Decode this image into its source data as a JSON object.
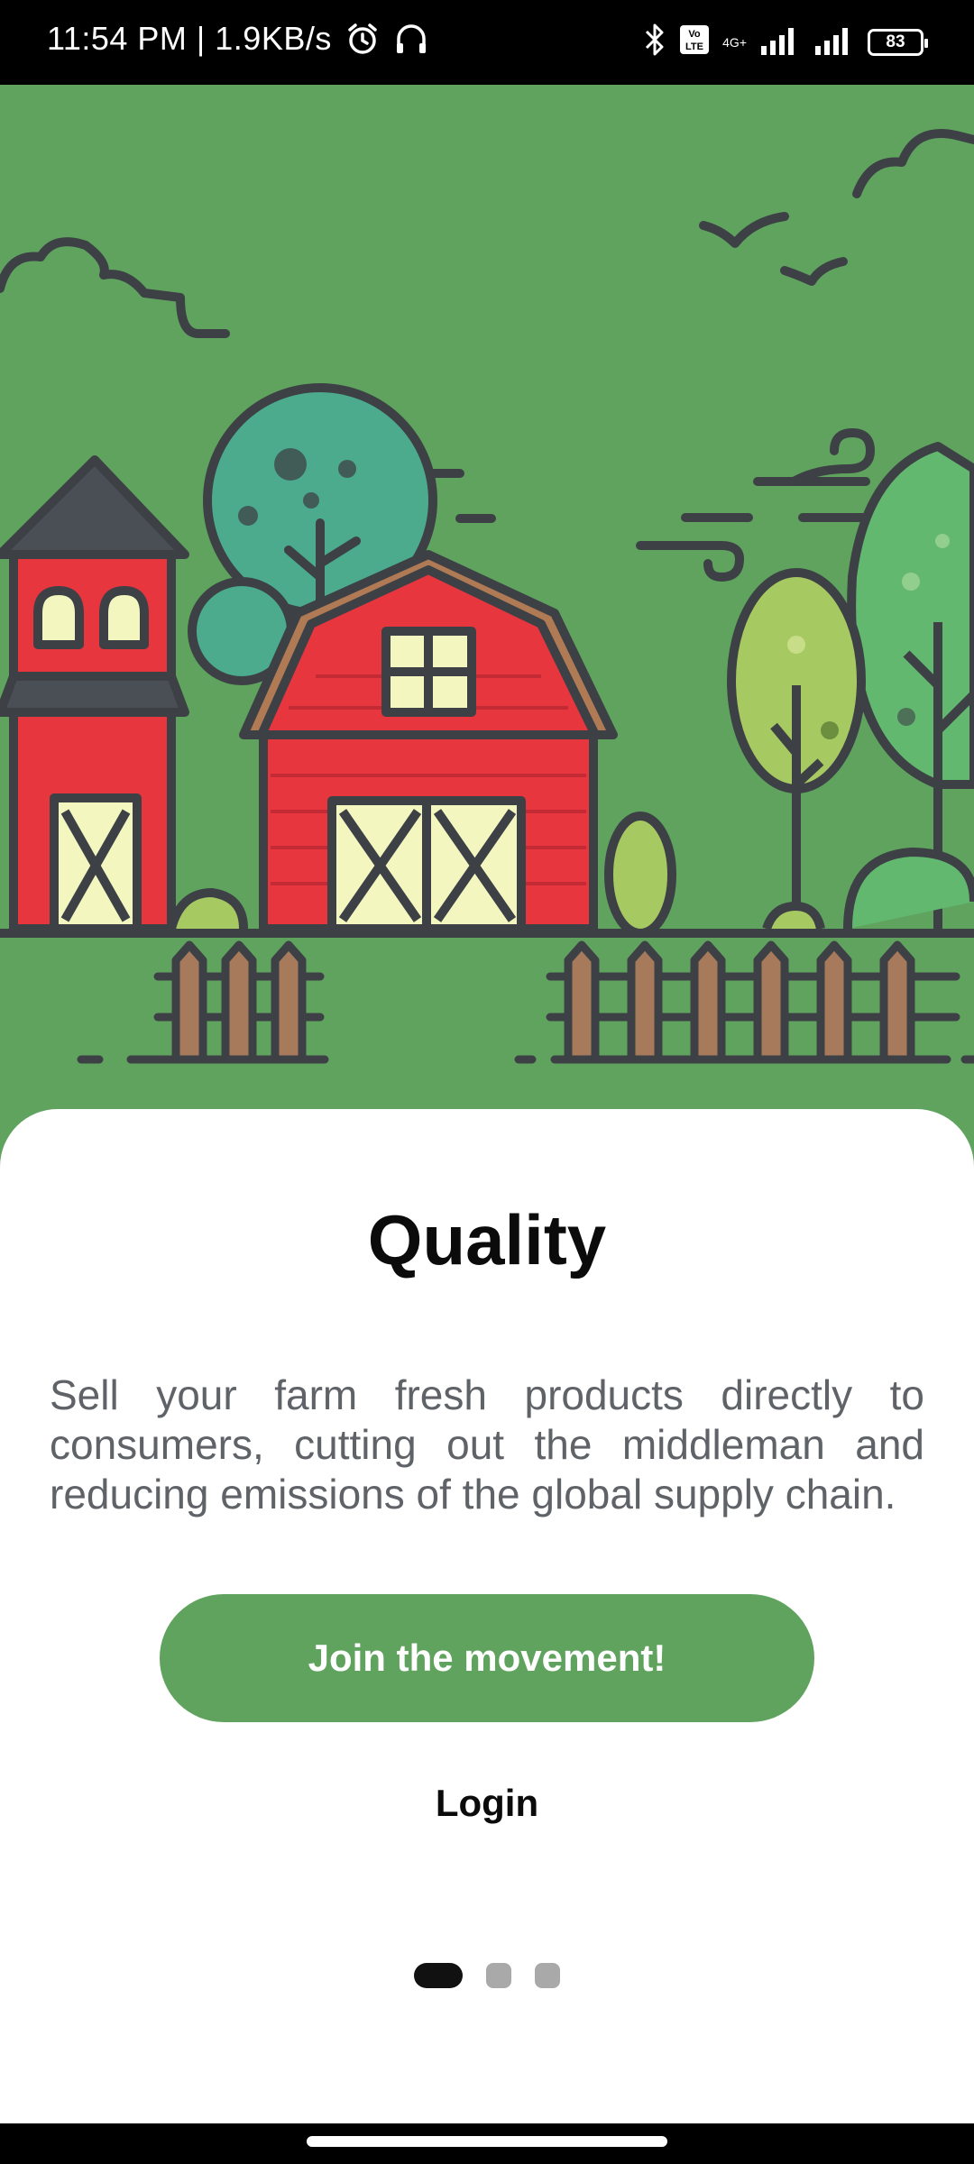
{
  "status_bar": {
    "time_speed": "11:54 PM | 1.9KB/s",
    "network_top": "4G+",
    "volte_label": "Vo LTE",
    "battery": "83",
    "icons": [
      "alarm-icon",
      "headset-icon",
      "bluetooth-icon",
      "volte-icon",
      "signal-icon",
      "signal-icon-2",
      "battery-icon"
    ]
  },
  "onboarding": {
    "title": "Quality",
    "description": "Sell your farm fresh products directly to consumers, cutting out the middleman and reducing emissions of the global supply chain.",
    "primary_button": "Join the movement!",
    "secondary_link": "Login",
    "page_indicator": {
      "total": 3,
      "active": 1
    }
  },
  "colors": {
    "brand_green": "#5fa35e",
    "barn_red": "#e8363f",
    "text_dark": "#0b0b0b",
    "text_gray": "#5f6368"
  }
}
